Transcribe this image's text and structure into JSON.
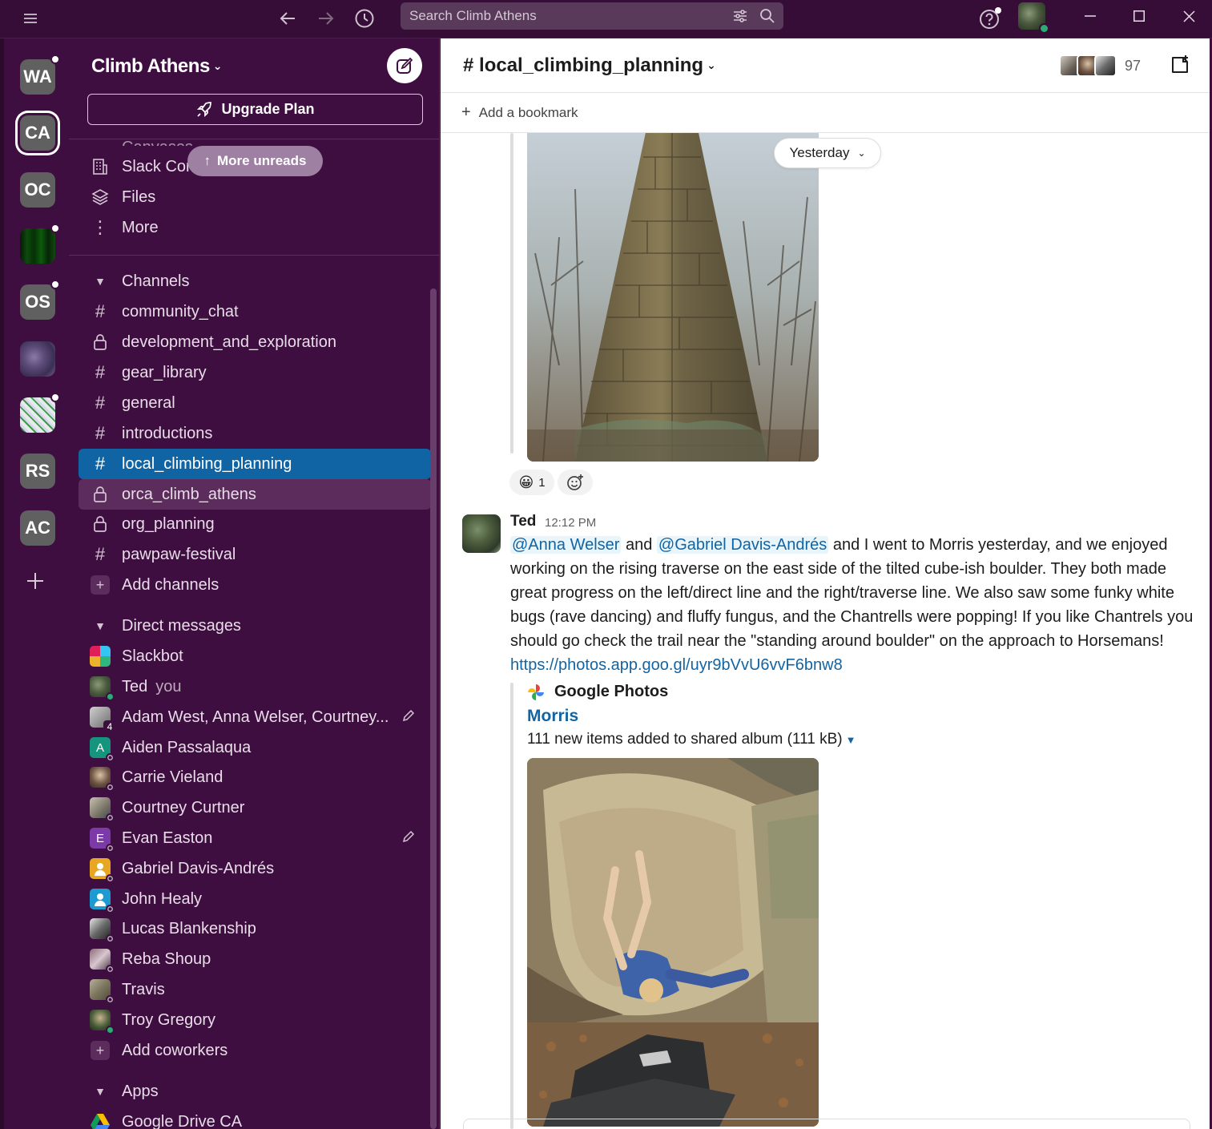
{
  "titlebar": {
    "search_placeholder": "Search Climb Athens"
  },
  "workspaces": [
    {
      "label": "WA",
      "unread": true
    },
    {
      "label": "CA",
      "active": true
    },
    {
      "label": "OC"
    },
    {
      "label": "",
      "unread": true
    },
    {
      "label": "OS",
      "unread": true
    },
    {
      "label": ""
    },
    {
      "label": "",
      "unread": true
    },
    {
      "label": "RS"
    },
    {
      "label": "AC"
    }
  ],
  "sidebar": {
    "workspace_name": "Climb Athens",
    "upgrade_label": "Upgrade Plan",
    "more_unreads": "More unreads",
    "canvases_label": "Canvases",
    "slack_connect_label": "Slack Con",
    "files_label": "Files",
    "more_label": "More",
    "channels_header": "Channels",
    "channels": [
      {
        "name": "community_chat",
        "private": false
      },
      {
        "name": "development_and_exploration",
        "private": true
      },
      {
        "name": "gear_library",
        "private": false
      },
      {
        "name": "general",
        "private": false
      },
      {
        "name": "introductions",
        "private": false
      },
      {
        "name": "local_climbing_planning",
        "private": false,
        "selected": true
      },
      {
        "name": "orca_climb_athens",
        "private": true
      },
      {
        "name": "org_planning",
        "private": true
      },
      {
        "name": "pawpaw-festival",
        "private": false
      }
    ],
    "add_channels": "Add channels",
    "dm_header": "Direct messages",
    "dms": [
      {
        "name": "Slackbot"
      },
      {
        "name": "Ted",
        "suffix": "you"
      },
      {
        "name": "Adam West, Anna Welser, Courtney...",
        "group_count": "4"
      },
      {
        "name": "Aiden Passalaqua",
        "initial": "A"
      },
      {
        "name": "Carrie Vieland"
      },
      {
        "name": "Courtney Curtner"
      },
      {
        "name": "Evan Easton",
        "initial": "E"
      },
      {
        "name": "Gabriel Davis-Andrés"
      },
      {
        "name": "John Healy"
      },
      {
        "name": "Lucas Blankenship"
      },
      {
        "name": "Reba Shoup"
      },
      {
        "name": "Travis"
      },
      {
        "name": "Troy Gregory"
      }
    ],
    "add_coworkers": "Add coworkers",
    "apps_header": "Apps",
    "apps": [
      {
        "name": "Google Drive CA"
      }
    ]
  },
  "channel": {
    "name": "local_climbing_planning",
    "member_count": "97",
    "add_bookmark": "Add a bookmark"
  },
  "messages": {
    "day_divider": "Yesterday",
    "reaction_emoji": "😀",
    "reaction_count": "1",
    "author": "Ted",
    "time": "12:12 PM",
    "mention1": "@Anna Welser",
    "and_text": " and ",
    "mention2": "@Gabriel Davis-Andrés",
    "body": " and I went to Morris yesterday, and we enjoyed working on the rising traverse on the east side of the tilted cube-ish boulder.  They both made great progress on the left/direct line and the right/traverse line.   We also saw some funky white bugs (rave dancing) and fluffy fungus, and the Chantrells were popping!  If you like Chantrels you should go check the trail near the \"standing around boulder\" on the approach to Horsemans!",
    "link": "https://photos.app.goo.gl/uyr9bVvU6vvF6bnw8",
    "unfurl": {
      "source": "Google Photos",
      "title": "Morris",
      "description": "111 new items added to shared album (111 kB)"
    }
  },
  "colors": {
    "sidebar_bg": "#3f0e40",
    "selected_bg": "#1164a3",
    "link": "#1264a3",
    "presence_active": "#2bac76"
  }
}
